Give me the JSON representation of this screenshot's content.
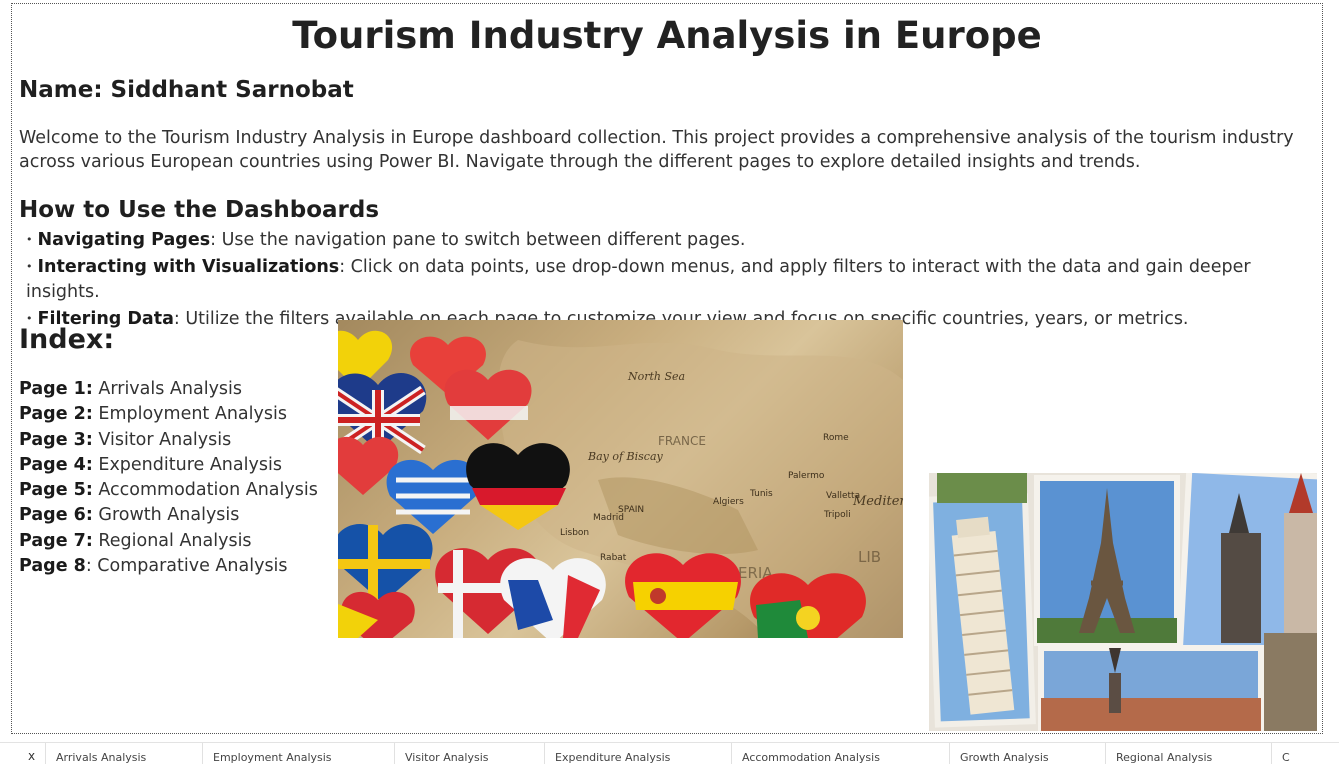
{
  "page": {
    "title": "Tourism Industry Analysis in Europe",
    "name_line": "Name: Siddhant Sarnobat",
    "intro": "Welcome to the Tourism Industry Analysis in Europe dashboard collection. This project provides a comprehensive analysis of the tourism industry across various European countries using Power BI. Navigate through the different pages to explore detailed insights and trends."
  },
  "howto": {
    "title": "How to Use the Dashboards",
    "items": [
      {
        "term": "Navigating Pages",
        "text": ": Use the navigation pane to switch between different pages."
      },
      {
        "term": "Interacting with Visualizations",
        "text": ": Click on data points, use drop-down menus, and apply filters to interact with the data and gain deeper insights."
      },
      {
        "term": "Filtering Data",
        "text": ": Utilize the filters available on each page to customize your view and focus on specific countries, years, or metrics."
      }
    ]
  },
  "index": {
    "title": "Index:",
    "items": [
      {
        "page": "Page 1:",
        "label": " Arrivals Analysis"
      },
      {
        "page": "Page 2:",
        "label": " Employment Analysis"
      },
      {
        "page": "Page 3:",
        "label": " Visitor Analysis"
      },
      {
        "page": "Page 4:",
        "label": " Expenditure Analysis"
      },
      {
        "page": "Page 5:",
        "label": " Accommodation Analysis"
      },
      {
        "page": "Page 6:",
        "label": " Growth Analysis"
      },
      {
        "page": "Page 7:",
        "label": " Regional Analysis"
      },
      {
        "page": "Page 8",
        "label": ": Comparative Analysis"
      }
    ]
  },
  "map_image": {
    "labels": [
      "North Sea",
      "Bay of Biscay",
      "SPAIN",
      "Lisbon",
      "Madrid",
      "Algiers",
      "Tunis",
      "Valletta",
      "Tripoli",
      "Mediter",
      "Rabat",
      "Palermo",
      "Rome",
      "FRANCE",
      "LIB",
      "ERIA"
    ]
  },
  "tabs": {
    "close_label": "x",
    "items": [
      "Arrivals Analysis",
      "Employment Analysis",
      "Visitor Analysis",
      "Expenditure Analysis",
      "Accommodation Analysis",
      "Growth Analysis",
      "Regional Analysis",
      "C"
    ]
  },
  "colors": {
    "title": "#222222",
    "body_text": "#333333",
    "border": "#555555"
  }
}
